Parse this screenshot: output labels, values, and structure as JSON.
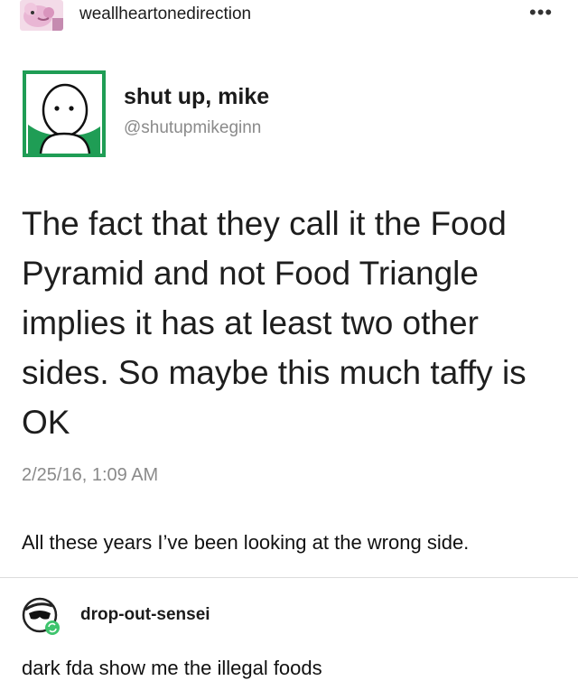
{
  "post": {
    "poster_username": "weallheartonedirection",
    "more_icon": "more-horizontal-icon",
    "poster_avatar_icon": "pink-pokemon-avatar"
  },
  "tweet": {
    "display_name": "shut up, mike",
    "handle": "@shutupmikeginn",
    "avatar_icon": "cartoon-face-avatar",
    "text": "The fact that they call it the Food Pyramid and not Food Triangle implies it has at least two other sides.  So maybe this much taffy is OK",
    "timestamp": "2/25/16, 1:09 AM"
  },
  "comments": [
    {
      "text": "All these years I’ve been looking at the wrong side."
    },
    {
      "username": "drop-out-sensei",
      "avatar_icon": "sunglasses-avatar",
      "reblog_badge_icon": "reblog-icon",
      "text": "dark fda show me the illegal foods"
    }
  ],
  "colors": {
    "tweet_avatar_bg": "#1f9d55",
    "reblog_badge": "#3ec46d",
    "secondary_text": "#8a8a8a",
    "poster_avatar_bg": "#e9b6d4"
  }
}
